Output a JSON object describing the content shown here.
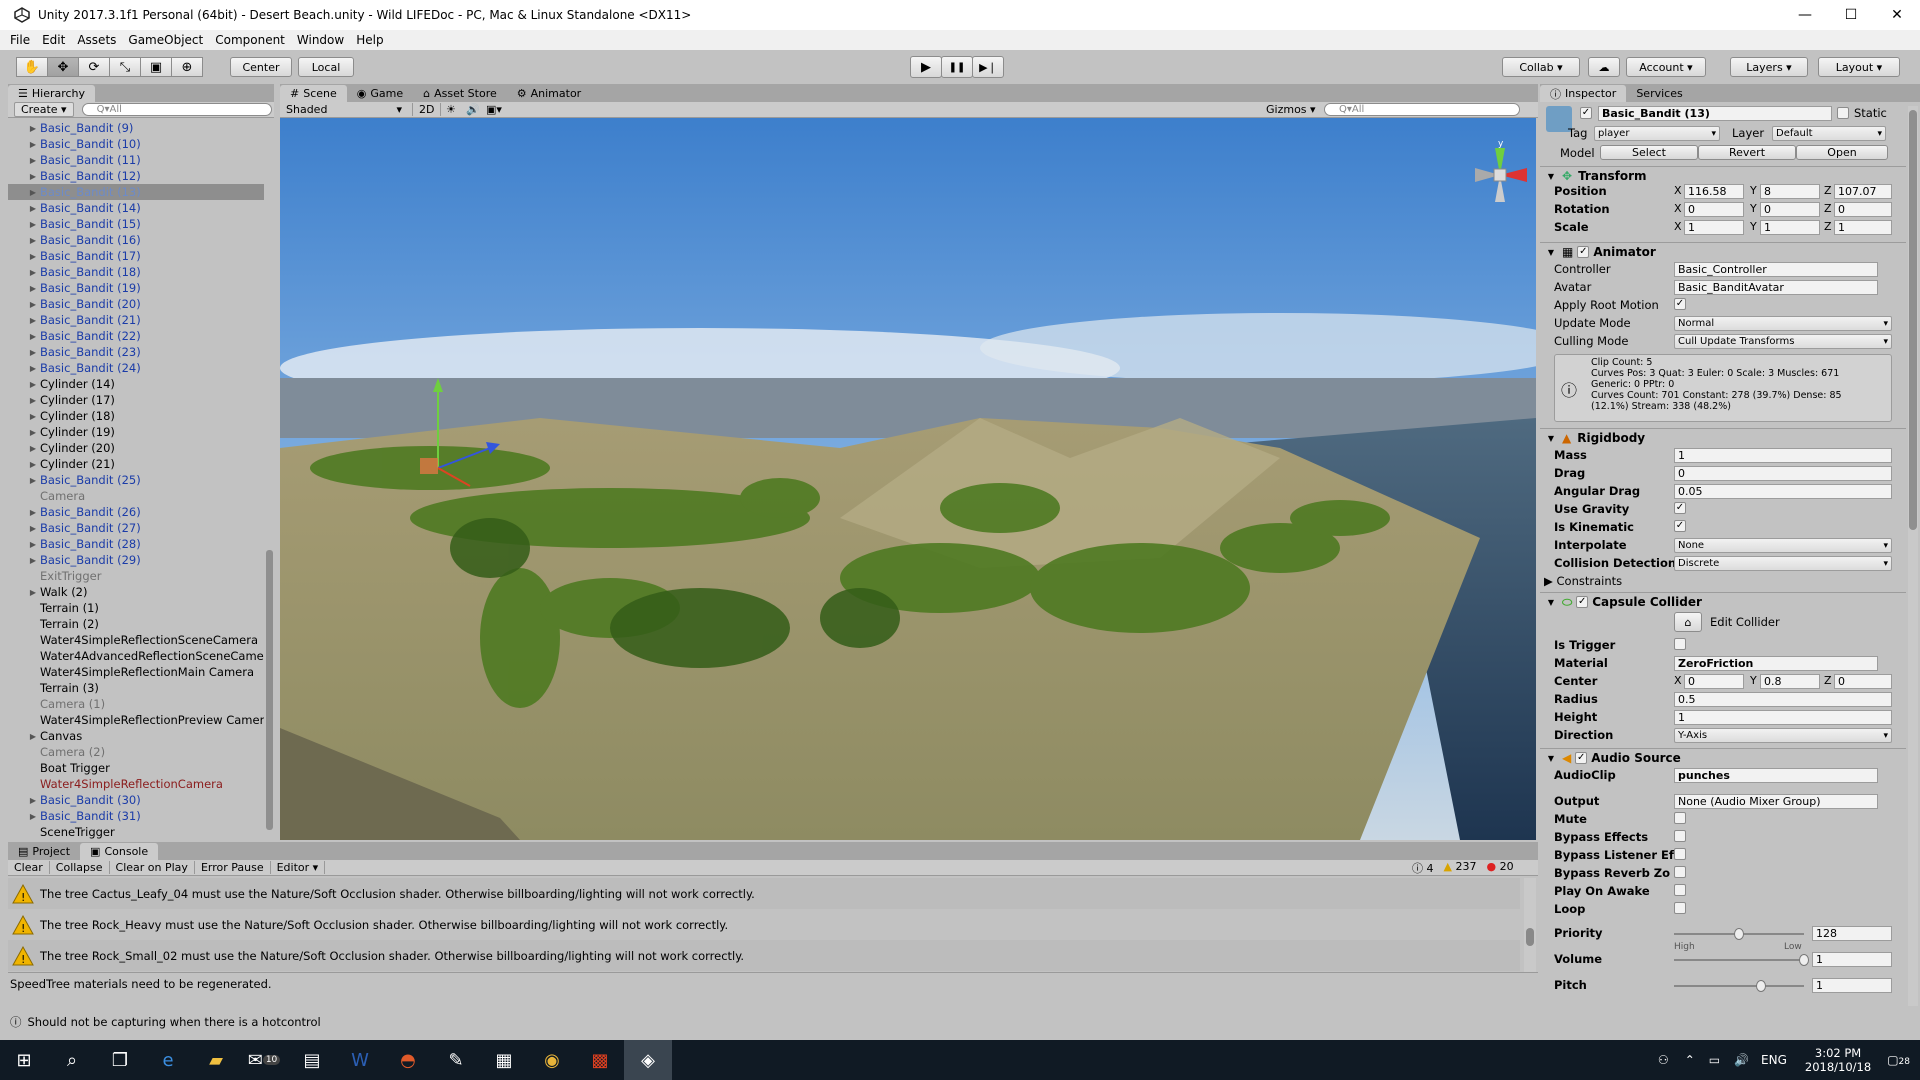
{
  "window": {
    "title": "Unity 2017.3.1f1 Personal (64bit) - Desert Beach.unity - Wild LIFEDoc - PC, Mac & Linux Standalone <DX11>",
    "controls": [
      "—",
      "☐",
      "✕"
    ]
  },
  "menu": [
    "File",
    "Edit",
    "Assets",
    "GameObject",
    "Component",
    "Window",
    "Help"
  ],
  "toolbar": {
    "tools": [
      "hand-tool-icon",
      "move-tool-icon",
      "rotate-tool-icon",
      "scale-tool-icon",
      "rect-tool-icon",
      "transform-tool-icon"
    ],
    "pivot": "Center",
    "space": "Local",
    "play": "▶",
    "pause": "❚❚",
    "step": "▶❘",
    "collab": "Collab ▾",
    "account": "Account",
    "layers": "Layers",
    "layout": "Layout"
  },
  "hierarchy": {
    "tab": "Hierarchy",
    "create": "Create",
    "search_placeholder": "Q▾All",
    "items": [
      {
        "label": "Basic_Bandit (9)",
        "type": "prefab",
        "arrow": true
      },
      {
        "label": "Basic_Bandit (10)",
        "type": "prefab",
        "arrow": true
      },
      {
        "label": "Basic_Bandit (11)",
        "type": "prefab",
        "arrow": true
      },
      {
        "label": "Basic_Bandit (12)",
        "type": "prefab",
        "arrow": true
      },
      {
        "label": "Basic_Bandit (13)",
        "type": "prefab",
        "arrow": true,
        "selected": true
      },
      {
        "label": "Basic_Bandit (14)",
        "type": "prefab",
        "arrow": true
      },
      {
        "label": "Basic_Bandit (15)",
        "type": "prefab",
        "arrow": true
      },
      {
        "label": "Basic_Bandit (16)",
        "type": "prefab",
        "arrow": true
      },
      {
        "label": "Basic_Bandit (17)",
        "type": "prefab",
        "arrow": true
      },
      {
        "label": "Basic_Bandit (18)",
        "type": "prefab",
        "arrow": true
      },
      {
        "label": "Basic_Bandit (19)",
        "type": "prefab",
        "arrow": true
      },
      {
        "label": "Basic_Bandit (20)",
        "type": "prefab",
        "arrow": true
      },
      {
        "label": "Basic_Bandit (21)",
        "type": "prefab",
        "arrow": true
      },
      {
        "label": "Basic_Bandit (22)",
        "type": "prefab",
        "arrow": true
      },
      {
        "label": "Basic_Bandit (23)",
        "type": "prefab",
        "arrow": true
      },
      {
        "label": "Basic_Bandit (24)",
        "type": "prefab",
        "arrow": true
      },
      {
        "label": "Cylinder (14)",
        "type": "normal",
        "arrow": true
      },
      {
        "label": "Cylinder (17)",
        "type": "normal",
        "arrow": true
      },
      {
        "label": "Cylinder (18)",
        "type": "normal",
        "arrow": true
      },
      {
        "label": "Cylinder (19)",
        "type": "normal",
        "arrow": true
      },
      {
        "label": "Cylinder (20)",
        "type": "normal",
        "arrow": true
      },
      {
        "label": "Cylinder (21)",
        "type": "normal",
        "arrow": true
      },
      {
        "label": "Basic_Bandit (25)",
        "type": "prefab",
        "arrow": true
      },
      {
        "label": "Camera",
        "type": "disabled",
        "arrow": false
      },
      {
        "label": "Basic_Bandit (26)",
        "type": "prefab",
        "arrow": true
      },
      {
        "label": "Basic_Bandit (27)",
        "type": "prefab",
        "arrow": true
      },
      {
        "label": "Basic_Bandit (28)",
        "type": "prefab",
        "arrow": true
      },
      {
        "label": "Basic_Bandit (29)",
        "type": "prefab",
        "arrow": true
      },
      {
        "label": "ExitTrigger",
        "type": "disabled",
        "arrow": false
      },
      {
        "label": "Walk (2)",
        "type": "normal",
        "arrow": true
      },
      {
        "label": "Terrain (1)",
        "type": "normal",
        "arrow": false
      },
      {
        "label": "Terrain (2)",
        "type": "normal",
        "arrow": false
      },
      {
        "label": "Water4SimpleReflectionSceneCamera",
        "type": "normal",
        "arrow": false
      },
      {
        "label": "Water4AdvancedReflectionSceneCame",
        "type": "normal",
        "arrow": false
      },
      {
        "label": "Water4SimpleReflectionMain Camera",
        "type": "normal",
        "arrow": false
      },
      {
        "label": "Terrain (3)",
        "type": "normal",
        "arrow": false
      },
      {
        "label": "Camera (1)",
        "type": "disabled",
        "arrow": false
      },
      {
        "label": "Water4SimpleReflectionPreview Camer",
        "type": "normal",
        "arrow": false
      },
      {
        "label": "Canvas",
        "type": "normal",
        "arrow": true
      },
      {
        "label": "Camera (2)",
        "type": "disabled",
        "arrow": false
      },
      {
        "label": "Boat Trigger",
        "type": "normal",
        "arrow": false
      },
      {
        "label": "Water4SimpleReflectionCamera",
        "type": "missing",
        "arrow": false
      },
      {
        "label": "Basic_Bandit (30)",
        "type": "prefab",
        "arrow": true
      },
      {
        "label": "Basic_Bandit (31)",
        "type": "prefab",
        "arrow": true
      },
      {
        "label": "SceneTrigger",
        "type": "normal",
        "arrow": false
      }
    ]
  },
  "scene": {
    "tabs": [
      "Scene",
      "Game",
      "Asset Store",
      "Animator"
    ],
    "shading": "Shaded",
    "mode_2d": "2D",
    "gizmos": "Gizmos",
    "search_placeholder": "Q▾All"
  },
  "console": {
    "tabs": [
      "Project",
      "Console"
    ],
    "buttons": [
      "Clear",
      "Collapse",
      "Clear on Play",
      "Error Pause",
      "Editor"
    ],
    "counts": {
      "info": "4",
      "warnings": "237",
      "errors": "20"
    },
    "messages": [
      "The tree Cactus_Leafy_04 must use the Nature/Soft Occlusion shader. Otherwise billboarding/lighting will not work correctly.",
      "The tree Rock_Heavy must use the Nature/Soft Occlusion shader. Otherwise billboarding/lighting will not work correctly.",
      "The tree Rock_Small_02 must use the Nature/Soft Occlusion shader. Otherwise billboarding/lighting will not work correctly."
    ],
    "footer_message": "SpeedTree materials need to be regenerated."
  },
  "status_bar": "Should not be capturing when there is a hotcontrol",
  "inspector": {
    "tabs": [
      "Inspector",
      "Services"
    ],
    "object_name": "Basic_Bandit (13)",
    "static_label": "Static",
    "tag_label": "Tag",
    "tag": "player",
    "layer_label": "Layer",
    "layer": "Default",
    "model_label": "Model",
    "model_buttons": [
      "Select",
      "Revert",
      "Open"
    ],
    "transform": {
      "title": "Transform",
      "position": {
        "label": "Position",
        "x": "116.58",
        "y": "8",
        "z": "107.07"
      },
      "rotation": {
        "label": "Rotation",
        "x": "0",
        "y": "0",
        "z": "0"
      },
      "scale": {
        "label": "Scale",
        "x": "1",
        "y": "1",
        "z": "1"
      }
    },
    "animator": {
      "title": "Animator",
      "controller_label": "Controller",
      "controller": "Basic_Controller",
      "avatar_label": "Avatar",
      "avatar": "Basic_BanditAvatar",
      "root_motion_label": "Apply Root Motion",
      "update_mode_label": "Update Mode",
      "update_mode": "Normal",
      "culling_mode_label": "Culling Mode",
      "culling_mode": "Cull Update Transforms",
      "info": "Clip Count: 5\nCurves Pos: 3 Quat: 3 Euler: 0 Scale: 3 Muscles: 671\nGeneric: 0 PPtr: 0\nCurves Count: 701 Constant: 278 (39.7%) Dense: 85\n(12.1%) Stream: 338 (48.2%)"
    },
    "rigidbody": {
      "title": "Rigidbody",
      "mass_label": "Mass",
      "mass": "1",
      "drag_label": "Drag",
      "drag": "0",
      "angular_drag_label": "Angular Drag",
      "angular_drag": "0.05",
      "use_gravity_label": "Use Gravity",
      "is_kinematic_label": "Is Kinematic",
      "interpolate_label": "Interpolate",
      "interpolate": "None",
      "collision_label": "Collision Detection",
      "collision": "Discrete",
      "constraints_label": "Constraints"
    },
    "capsule": {
      "title": "Capsule Collider",
      "edit_label": "Edit Collider",
      "is_trigger_label": "Is Trigger",
      "material_label": "Material",
      "material": "ZeroFriction",
      "center_label": "Center",
      "center_x": "0",
      "center_y": "0.8",
      "center_z": "0",
      "radius_label": "Radius",
      "radius": "0.5",
      "height_label": "Height",
      "height": "1",
      "direction_label": "Direction",
      "direction": "Y-Axis"
    },
    "audio": {
      "title": "Audio Source",
      "clip_label": "AudioClip",
      "clip": "punches",
      "output_label": "Output",
      "output": "None (Audio Mixer Group)",
      "mute_label": "Mute",
      "bypass_effects_label": "Bypass Effects",
      "bypass_listener_label": "Bypass Listener Ef",
      "bypass_reverb_label": "Bypass Reverb Zo",
      "play_on_awake_label": "Play On Awake",
      "loop_label": "Loop",
      "priority_label": "Priority",
      "priority": "128",
      "priority_high": "High",
      "priority_low": "Low",
      "priority_level": 0.5,
      "volume_label": "Volume",
      "volume": "1",
      "volume_level": 1.0,
      "pitch_label": "Pitch",
      "pitch": "1",
      "pitch_level": 0.67
    }
  },
  "taskbar": {
    "time": "3:02 PM",
    "date": "2018/10/18",
    "lang": "ENG",
    "mail_badge": "10",
    "notif_badge": "28"
  }
}
